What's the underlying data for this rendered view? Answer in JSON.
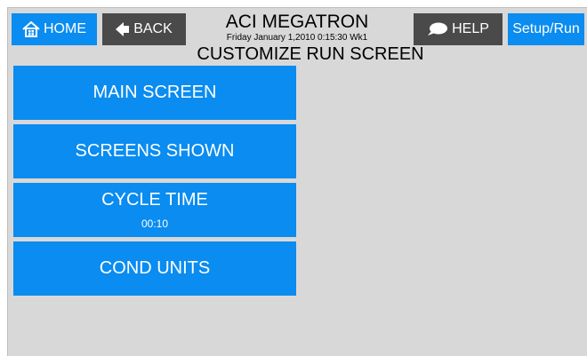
{
  "header": {
    "home_label": "HOME",
    "back_label": "BACK",
    "title": "ACI MEGATRON",
    "datetime": "Friday January 1,2010 0:15:30 Wk1",
    "help_label": "HELP",
    "setup_run_label": "Setup/Run",
    "subtitle": "CUSTOMIZE RUN SCREEN"
  },
  "menu": {
    "main_screen": "MAIN SCREEN",
    "screens_shown": "SCREENS SHOWN",
    "cycle_time": "CYCLE TIME",
    "cycle_time_value": "00:10",
    "cond_units": "COND UNITS"
  },
  "icons": {
    "home": "house-icon",
    "back": "left-arrow-icon",
    "help": "speech-bubble-icon"
  },
  "colors": {
    "button_blue": "#0a8cf0",
    "button_gray": "#4a4a4a",
    "background": "#d8d8d8"
  }
}
